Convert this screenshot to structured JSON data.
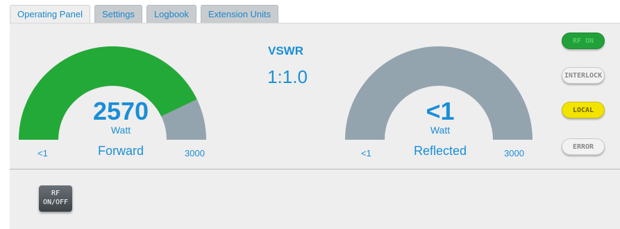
{
  "tabs": [
    {
      "label": "Operating Panel",
      "active": true
    },
    {
      "label": "Settings",
      "active": false
    },
    {
      "label": "Logbook",
      "active": false
    },
    {
      "label": "Extension Units",
      "active": false
    }
  ],
  "colors": {
    "accent": "#1a8ed6",
    "gauge_fill": "#23a937",
    "gauge_track": "#94a4ae",
    "rf_on": "#22a13a",
    "local": "#f3e400",
    "rf_button": "#4d5257",
    "panel": "#eeeeee"
  },
  "forward_gauge": {
    "value": "2570",
    "unit": "Watt",
    "label": "Forward",
    "min": "<1",
    "max": "3000",
    "fraction": 0.857
  },
  "reflected_gauge": {
    "value": "<1",
    "unit": "Watt",
    "label": "Reflected",
    "min": "<1",
    "max": "3000",
    "fraction": 0
  },
  "vswr": {
    "title": "VSWR",
    "value": "1:1.0"
  },
  "status": {
    "rf_on": "RF ON",
    "interlock": "INTERLOCK",
    "local": "LOCAL",
    "error": "ERROR"
  },
  "rf_button": {
    "line1": "RF",
    "line2": "ON/OFF"
  }
}
